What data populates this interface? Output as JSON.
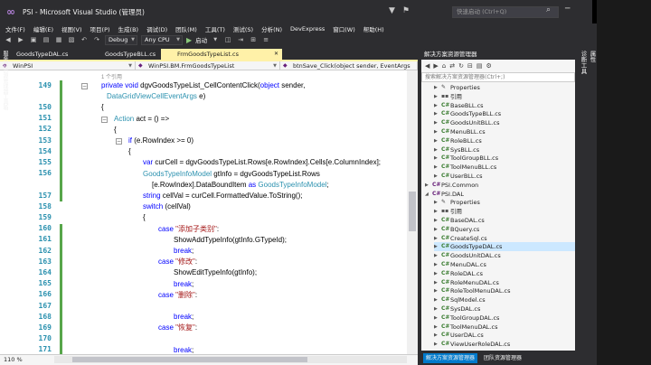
{
  "window": {
    "title": "PSI - Microsoft Visual Studio (管理员)",
    "quick_launch_placeholder": "快速启动 (Ctrl+Q)",
    "logo": "visual-studio-logo"
  },
  "menu": [
    "文件(F)",
    "编辑(E)",
    "视图(V)",
    "项目(P)",
    "生成(B)",
    "调试(D)",
    "团队(M)",
    "工具(T)",
    "测试(S)",
    "分析(N)",
    "DevExpress",
    "窗口(W)",
    "帮助(H)"
  ],
  "toolbar": {
    "config": "Debug",
    "platform": "Any CPU",
    "start": "启动"
  },
  "tabs": [
    {
      "label": "GoodsTypeDAL.cs",
      "active": false
    },
    {
      "label": "GoodsTypeBLL.cs",
      "active": false
    },
    {
      "label": "FrmGoodsTypeList.cs",
      "active": true
    }
  ],
  "nav": {
    "project": "WinPSI",
    "class": "WinPSI.BM.FrmGoodsTypeList",
    "member": "btnSave_Click(object sender, EventArgs e)"
  },
  "code": {
    "ref_hint": "1 个引用",
    "lines": [
      {
        "n": "149",
        "segs": [
          [
            "kw",
            "private void "
          ],
          [
            "",
            "dgvGoodsTypeList_CellContentClick("
          ],
          [
            "kw",
            "object "
          ],
          [
            "",
            "sender,"
          ]
        ]
      },
      {
        "n": "",
        "segs": [
          [
            "ty",
            "DataGridViewCellEventArgs "
          ],
          [
            "",
            "e)"
          ]
        ]
      },
      {
        "n": "150",
        "segs": [
          [
            "",
            "{"
          ]
        ]
      },
      {
        "n": "151",
        "segs": [
          [
            "ty",
            "Action "
          ],
          [
            "",
            "act = () =>"
          ]
        ]
      },
      {
        "n": "152",
        "segs": [
          [
            "",
            "{"
          ]
        ]
      },
      {
        "n": "153",
        "segs": [
          [
            "kw",
            "if "
          ],
          [
            "",
            "(e.RowIndex >= 0)"
          ]
        ]
      },
      {
        "n": "154",
        "segs": [
          [
            "",
            "{"
          ]
        ]
      },
      {
        "n": "155",
        "segs": [
          [
            "kw",
            "var "
          ],
          [
            "",
            "curCell = dgvGoodsTypeList.Rows[e.RowIndex].Cells[e.ColumnIndex];"
          ]
        ]
      },
      {
        "n": "156",
        "segs": [
          [
            "ty",
            "GoodsTypeInfoModel "
          ],
          [
            "",
            "gtInfo = dgvGoodsTypeList.Rows"
          ]
        ]
      },
      {
        "n": "",
        "segs": [
          [
            "",
            "[e.RowIndex].DataBoundItem "
          ],
          [
            "kw",
            "as "
          ],
          [
            "ty",
            "GoodsTypeInfoModel"
          ],
          [
            "",
            ";"
          ]
        ]
      },
      {
        "n": "157",
        "segs": [
          [
            "kw",
            "string "
          ],
          [
            "",
            "cellVal = curCell.FormattedValue.ToString();"
          ]
        ]
      },
      {
        "n": "158",
        "segs": [
          [
            "kw",
            "switch "
          ],
          [
            "",
            "(cellVal)"
          ]
        ]
      },
      {
        "n": "159",
        "segs": [
          [
            "",
            "{"
          ]
        ]
      },
      {
        "n": "160",
        "segs": [
          [
            "kw",
            "case "
          ],
          [
            "st",
            "\"添加子类别\""
          ],
          [
            "",
            ":"
          ]
        ]
      },
      {
        "n": "161",
        "segs": [
          [
            "",
            "ShowAddTypeInfo(gtInfo.GTypeId);"
          ]
        ]
      },
      {
        "n": "162",
        "segs": [
          [
            "kw",
            "break"
          ],
          [
            "",
            ";"
          ]
        ]
      },
      {
        "n": "163",
        "segs": [
          [
            "kw",
            "case "
          ],
          [
            "st",
            "\"修改\""
          ],
          [
            "",
            ":"
          ]
        ]
      },
      {
        "n": "164",
        "segs": [
          [
            "",
            "ShowEditTypeInfo(gtInfo);"
          ]
        ]
      },
      {
        "n": "165",
        "segs": [
          [
            "kw",
            "break"
          ],
          [
            "",
            ";"
          ]
        ]
      },
      {
        "n": "166",
        "segs": [
          [
            "kw",
            "case "
          ],
          [
            "st",
            "\"删除\""
          ],
          [
            "",
            ":"
          ]
        ]
      },
      {
        "n": "167",
        "segs": [
          [
            "",
            ""
          ]
        ]
      },
      {
        "n": "168",
        "segs": [
          [
            "kw",
            "break"
          ],
          [
            "",
            ";"
          ]
        ]
      },
      {
        "n": "169",
        "segs": [
          [
            "kw",
            "case "
          ],
          [
            "st",
            "\"恢复\""
          ],
          [
            "",
            ":"
          ]
        ]
      },
      {
        "n": "170",
        "segs": [
          [
            "",
            ""
          ]
        ]
      },
      {
        "n": "171",
        "segs": [
          [
            "kw",
            "break"
          ],
          [
            "",
            ";"
          ]
        ]
      }
    ]
  },
  "status": {
    "zoom": "110 %"
  },
  "solution_explorer": {
    "title": "解决方案资源管理器",
    "search_placeholder": "搜索解决方案资源管理器(Ctrl+;)",
    "items": [
      {
        "label": "Properties",
        "icon": "wrench-icon",
        "indent": 2,
        "expand": "▶"
      },
      {
        "label": "引用",
        "icon": "references-icon",
        "indent": 2,
        "expand": "▶"
      },
      {
        "label": "BaseBLL.cs",
        "icon": "csharp-file-icon",
        "indent": 2,
        "expand": "▶"
      },
      {
        "label": "GoodsTypeBLL.cs",
        "icon": "csharp-file-icon",
        "indent": 2,
        "expand": "▶"
      },
      {
        "label": "GoodsUnitBLL.cs",
        "icon": "csharp-file-icon",
        "indent": 2,
        "expand": "▶"
      },
      {
        "label": "MenuBLL.cs",
        "icon": "csharp-file-icon",
        "indent": 2,
        "expand": "▶"
      },
      {
        "label": "RoleBLL.cs",
        "icon": "csharp-file-icon",
        "indent": 2,
        "expand": "▶"
      },
      {
        "label": "SysBLL.cs",
        "icon": "csharp-file-icon",
        "indent": 2,
        "expand": "▶"
      },
      {
        "label": "ToolGroupBLL.cs",
        "icon": "csharp-file-icon",
        "indent": 2,
        "expand": "▶"
      },
      {
        "label": "ToolMenuBLL.cs",
        "icon": "csharp-file-icon",
        "indent": 2,
        "expand": "▶"
      },
      {
        "label": "UserBLL.cs",
        "icon": "csharp-file-icon",
        "indent": 2,
        "expand": "▶"
      },
      {
        "label": "PSI.Common",
        "icon": "csharp-project-icon",
        "indent": 1,
        "expand": "▶"
      },
      {
        "label": "PSI.DAL",
        "icon": "csharp-project-icon",
        "indent": 1,
        "expand": "◢"
      },
      {
        "label": "Properties",
        "icon": "wrench-icon",
        "indent": 2,
        "expand": "▶"
      },
      {
        "label": "引用",
        "icon": "references-icon",
        "indent": 2,
        "expand": "▶"
      },
      {
        "label": "BaseDAL.cs",
        "icon": "csharp-file-icon",
        "indent": 2,
        "expand": "▶"
      },
      {
        "label": "BQuery.cs",
        "icon": "csharp-file-icon",
        "indent": 2,
        "expand": "▶"
      },
      {
        "label": "CreateSql.cs",
        "icon": "csharp-file-icon",
        "indent": 2,
        "expand": "▶"
      },
      {
        "label": "GoodsTypeDAL.cs",
        "icon": "csharp-file-icon",
        "indent": 2,
        "expand": "▶",
        "selected": true
      },
      {
        "label": "GoodsUnitDAL.cs",
        "icon": "csharp-file-icon",
        "indent": 2,
        "expand": "▶"
      },
      {
        "label": "MenuDAL.cs",
        "icon": "csharp-file-icon",
        "indent": 2,
        "expand": "▶"
      },
      {
        "label": "RoleDAL.cs",
        "icon": "csharp-file-icon",
        "indent": 2,
        "expand": "▶"
      },
      {
        "label": "RoleMenuDAL.cs",
        "icon": "csharp-file-icon",
        "indent": 2,
        "expand": "▶"
      },
      {
        "label": "RoleToolMenuDAL.cs",
        "icon": "csharp-file-icon",
        "indent": 2,
        "expand": "▶"
      },
      {
        "label": "SqlModel.cs",
        "icon": "csharp-file-icon",
        "indent": 2,
        "expand": "▶"
      },
      {
        "label": "SysDAL.cs",
        "icon": "csharp-file-icon",
        "indent": 2,
        "expand": "▶"
      },
      {
        "label": "ToolGroupDAL.cs",
        "icon": "csharp-file-icon",
        "indent": 2,
        "expand": "▶"
      },
      {
        "label": "ToolMenuDAL.cs",
        "icon": "csharp-file-icon",
        "indent": 2,
        "expand": "▶"
      },
      {
        "label": "UserDAL.cs",
        "icon": "csharp-file-icon",
        "indent": 2,
        "expand": "▶"
      },
      {
        "label": "ViewUserRoleDAL.cs",
        "icon": "csharp-file-icon",
        "indent": 2,
        "expand": "▶"
      }
    ],
    "bottom_tabs": [
      "解决方案资源管理器",
      "团队资源管理器"
    ]
  },
  "rails": {
    "left": [
      "服务器资源管理器",
      "工具箱"
    ],
    "right": [
      "诊断工具",
      "属性"
    ]
  },
  "colors": {
    "accent": "#007acc",
    "active_tab": "#fff1a8",
    "keyword": "#0000ff",
    "type": "#2b91af",
    "string": "#a31515",
    "selection": "#cce8ff"
  }
}
